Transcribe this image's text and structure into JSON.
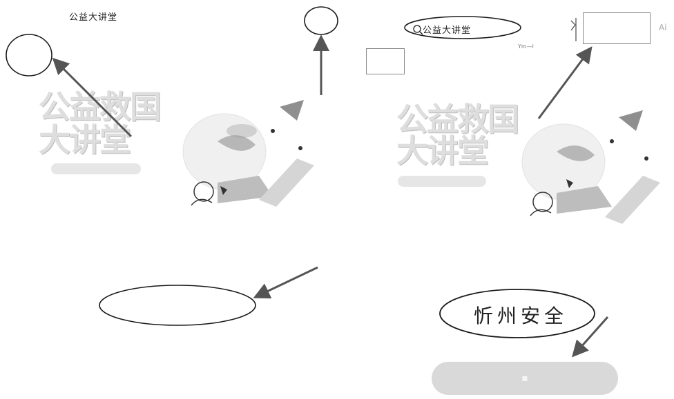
{
  "left": {
    "header_title": "公益大讲堂",
    "banner_title_line1": "公益救国",
    "banner_title_line2": "大讲堂"
  },
  "right": {
    "search_label": "公益大讲堂",
    "banner_title_line1": "公益救国",
    "banner_title_line2": "大讲堂",
    "tiny_label": "Ym—l",
    "corner_text": "Ai",
    "annotation_text": "忻州安全"
  },
  "colors": {
    "annotation": "#1a1a1a",
    "arrow": "#555555",
    "illustration": "#bdbdbd"
  }
}
